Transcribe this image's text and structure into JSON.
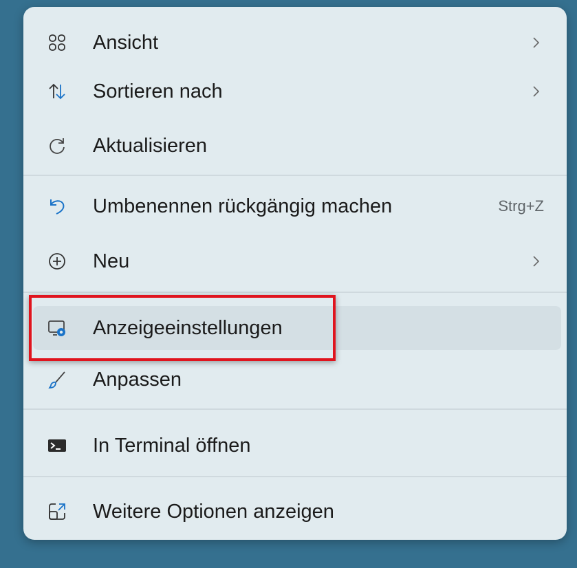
{
  "context_menu": {
    "items": [
      {
        "label": "Ansicht",
        "icon": "grid-view-icon",
        "has_submenu": true
      },
      {
        "label": "Sortieren nach",
        "icon": "sort-icon",
        "has_submenu": true
      },
      {
        "label": "Aktualisieren",
        "icon": "refresh-icon",
        "has_submenu": false
      },
      {
        "label": "Umbenennen rückgängig machen",
        "icon": "undo-icon",
        "shortcut": "Strg+Z"
      },
      {
        "label": "Neu",
        "icon": "new-plus-icon",
        "has_submenu": true
      },
      {
        "label": "Anzeigeeinstellungen",
        "icon": "display-settings-icon",
        "hovered": true
      },
      {
        "label": "Anpassen",
        "icon": "brush-icon"
      },
      {
        "label": "In Terminal öffnen",
        "icon": "terminal-icon"
      },
      {
        "label": "Weitere Optionen anzeigen",
        "icon": "more-options-icon"
      }
    ]
  },
  "colors": {
    "desktop_background": "#35708f",
    "menu_background": "#e1ebef",
    "hover_background": "#d4dfe4",
    "highlight_box": "#e0141e",
    "accent_blue": "#1a73c8"
  }
}
